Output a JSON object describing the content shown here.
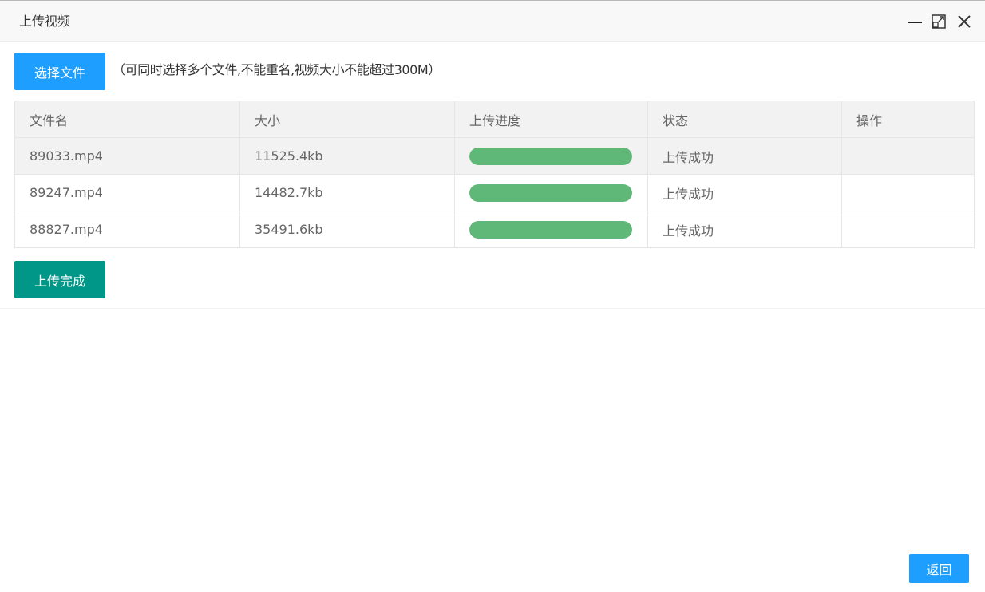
{
  "window": {
    "title": "上传视频",
    "minimize_icon": "minimize-icon",
    "maximize_icon": "maximize-icon",
    "close_icon": "close-icon"
  },
  "toolbar": {
    "choose_label": "选择文件",
    "hint": "（可同时选择多个文件,不能重名,视频大小不能超过300M）"
  },
  "table": {
    "columns": [
      "文件名",
      "大小",
      "上传进度",
      "状态",
      "操作"
    ],
    "rows": [
      {
        "name": "89033.mp4",
        "size": "11525.4kb",
        "progress": 1.0,
        "status": "上传成功",
        "action": ""
      },
      {
        "name": "89247.mp4",
        "size": "14482.7kb",
        "progress": 1.0,
        "status": "上传成功",
        "action": ""
      },
      {
        "name": "88827.mp4",
        "size": "35491.6kb",
        "progress": 1.0,
        "status": "上传成功",
        "action": ""
      }
    ]
  },
  "done_label": "上传完成",
  "back_label": "返回",
  "colors": {
    "primary": "#1e9fff",
    "teal": "#009688",
    "success": "#5fb878"
  }
}
